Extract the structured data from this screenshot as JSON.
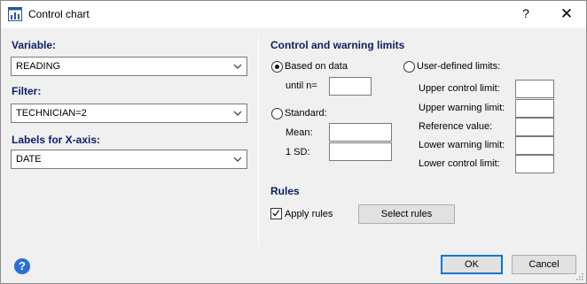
{
  "window": {
    "title": "Control chart",
    "help_glyph": "?",
    "close_glyph": "✕"
  },
  "left": {
    "variable_label": "Variable:",
    "variable_value": "READING",
    "filter_label": "Filter:",
    "filter_value": "TECHNICIAN=2",
    "xaxis_label": "Labels for X-axis:",
    "xaxis_value": "DATE"
  },
  "limits": {
    "section_title": "Control and warning limits",
    "based_on_data_label": "Based on data",
    "based_on_data_checked": true,
    "until_n_label": "until n=",
    "until_n_value": "",
    "standard_label": "Standard:",
    "standard_checked": false,
    "mean_label": "Mean:",
    "mean_value": "",
    "sd_label": "1 SD:",
    "sd_value": "",
    "user_defined_label": "User-defined limits:",
    "user_defined_checked": false,
    "ucl_label": "Upper control limit:",
    "uwl_label": "Upper warning limit:",
    "ref_label": "Reference value:",
    "lwl_label": "Lower warning limit:",
    "lcl_label": "Lower control limit:"
  },
  "rules": {
    "section_title": "Rules",
    "apply_label": "Apply rules",
    "apply_checked": true,
    "select_button": "Select rules"
  },
  "footer": {
    "help_glyph": "?",
    "ok_label": "OK",
    "cancel_label": "Cancel"
  },
  "colors": {
    "section_title": "#0b1f66",
    "help_icon": "#2a6fd6",
    "default_button_border": "#0078d7"
  }
}
